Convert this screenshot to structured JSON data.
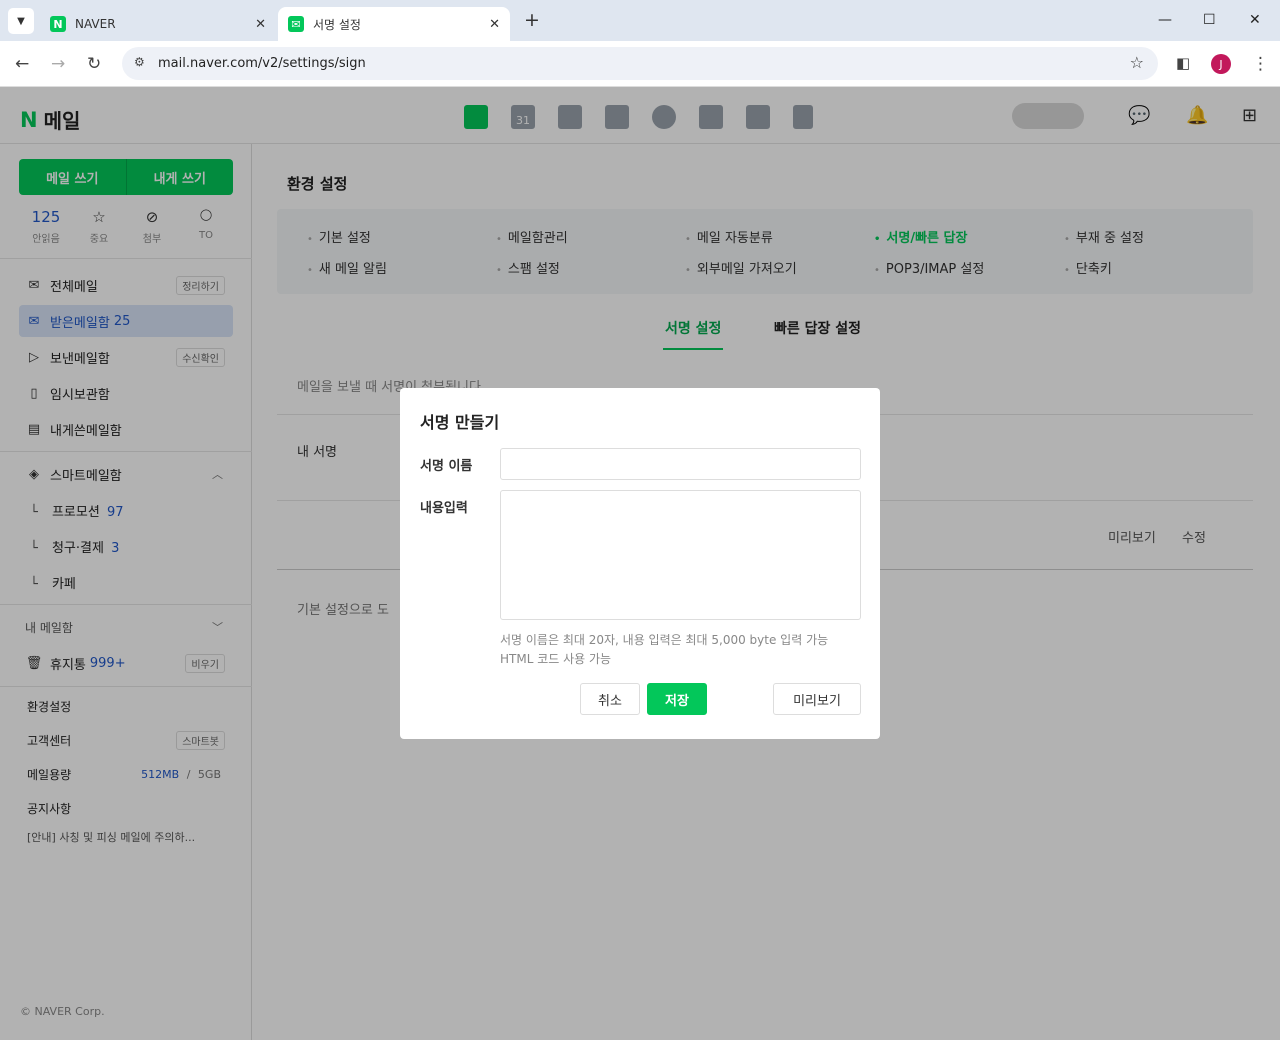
{
  "browser": {
    "tabs": [
      {
        "title": "NAVER"
      },
      {
        "title": "서명 설정"
      }
    ],
    "new_tab": "+",
    "url": "mail.naver.com/v2/settings/sign",
    "profile_initial": "J"
  },
  "header": {
    "logo_letter": "N",
    "logo_text": "메일",
    "calendar_day": "31",
    "user_name": "blurred"
  },
  "sidebar": {
    "compose_label": "메일 쓰기",
    "self_compose_label": "내게 쓰기",
    "quick": [
      {
        "value": "125",
        "label": "안읽음"
      },
      {
        "icon": "star-icon",
        "label": "중요"
      },
      {
        "icon": "paperclip-icon",
        "label": "첨부"
      },
      {
        "icon": "todo-icon",
        "label": "TO"
      }
    ],
    "folders": [
      {
        "label": "전체메일",
        "pill": "정리하기"
      },
      {
        "label": "받은메일함",
        "count": "25"
      },
      {
        "label": "보낸메일함",
        "pill": "수신확인"
      },
      {
        "label": "임시보관함"
      },
      {
        "label": "내게쓴메일함"
      }
    ],
    "smart_label": "스마트메일함",
    "smart_items": [
      {
        "label": "프로모션",
        "count": "97"
      },
      {
        "label": "청구·결제",
        "count": "3"
      },
      {
        "label": "카페"
      }
    ],
    "my_mailbox_label": "내 메일함",
    "trash_label": "휴지통",
    "trash_count": "999+",
    "trash_pill": "비우기",
    "footer": {
      "settings": "환경설정",
      "help": "고객센터",
      "help_pill": "스마트봇",
      "storage_label": "메일용량",
      "storage_used": "512MB",
      "storage_sep": "/",
      "storage_total": "5GB",
      "notice": "공지사항",
      "notice_text": "[안내] 사칭 및 피싱 메일에 주의하..."
    },
    "copyright": "© NAVER Corp."
  },
  "main": {
    "title": "환경 설정",
    "menu": [
      "기본 설정",
      "메일함관리",
      "메일 자동분류",
      "서명/빠른 답장",
      "부재 중 설정",
      "새 메일 알림",
      "스팸 설정",
      "외부메일 가져오기",
      "POP3/IMAP 설정",
      "단축키"
    ],
    "subtabs": [
      "서명 설정",
      "빠른 답장 설정"
    ],
    "desc": "메일을 보낼 때 서명이 첨부됩니다",
    "my_sign_label": "내 서명",
    "preview_link": "미리보기",
    "edit_link": "수정",
    "default_text": "기본 설정으로 도"
  },
  "modal": {
    "title": "서명 만들기",
    "name_label": "서명 이름",
    "name_value": "",
    "content_label": "내용입력",
    "content_value": "",
    "help_line1": "서명 이름은 최대 20자, 내용 입력은 최대 5,000 byte 입력 가능",
    "help_line2": "HTML 코드 사용 가능",
    "cancel": "취소",
    "save": "저장",
    "preview": "미리보기"
  }
}
